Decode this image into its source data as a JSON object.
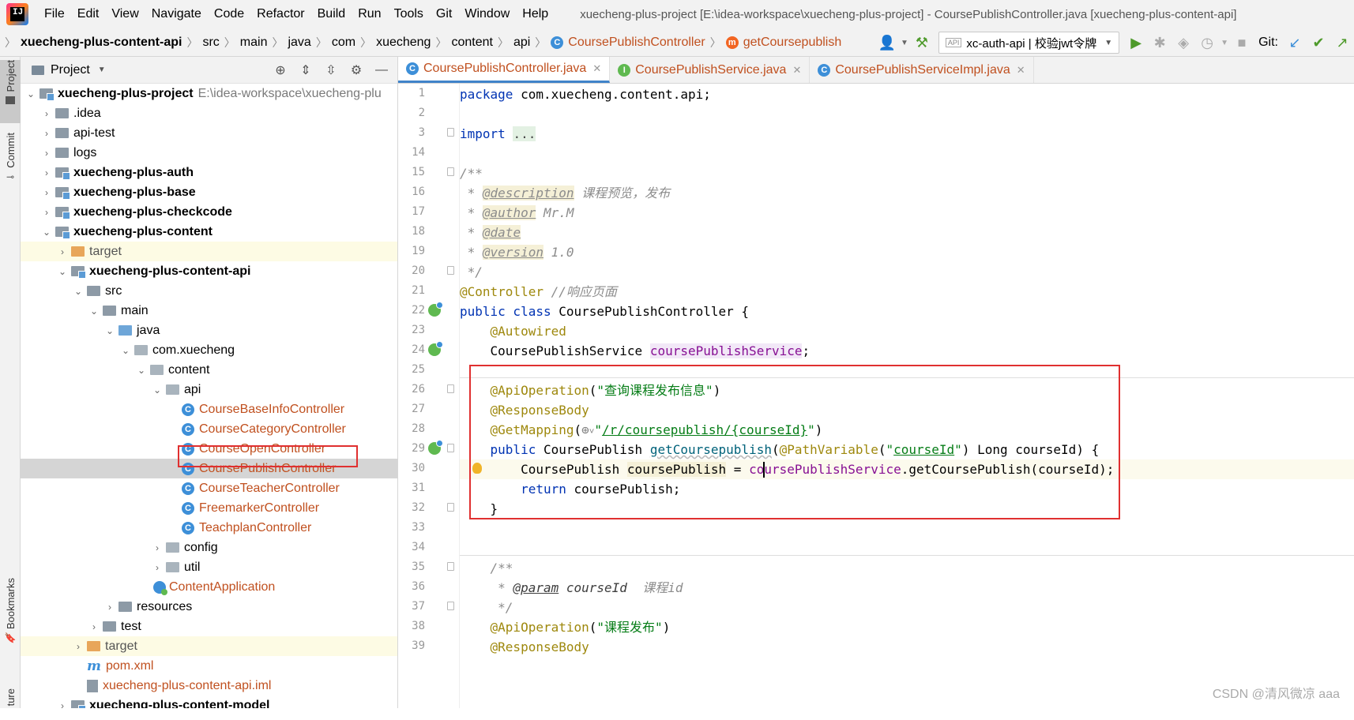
{
  "menubar": {
    "items": [
      "File",
      "Edit",
      "View",
      "Navigate",
      "Code",
      "Refactor",
      "Build",
      "Run",
      "Tools",
      "Git",
      "Window",
      "Help"
    ],
    "title": "xuecheng-plus-project [E:\\idea-workspace\\xuecheng-plus-project] - CoursePublishController.java [xuecheng-plus-content-api]"
  },
  "navbar": {
    "crumbs": [
      "xuecheng-plus-content-api",
      "src",
      "main",
      "java",
      "com",
      "xuecheng",
      "content",
      "api",
      "CoursePublishController",
      "getCoursepublish"
    ],
    "run_config": "xc-auth-api | 校验jwt令牌",
    "api_badge": "API",
    "git_label": "Git:"
  },
  "left_strip": {
    "project": "Project",
    "commit": "Commit",
    "bookmarks": "Bookmarks",
    "structure": "ture"
  },
  "project_panel": {
    "title": "Project",
    "tree": [
      {
        "label": "xuecheng-plus-project",
        "path": "E:\\idea-workspace\\xuecheng-plu"
      },
      {
        "label": ".idea"
      },
      {
        "label": "api-test"
      },
      {
        "label": "logs"
      },
      {
        "label": "xuecheng-plus-auth"
      },
      {
        "label": "xuecheng-plus-base"
      },
      {
        "label": "xuecheng-plus-checkcode"
      },
      {
        "label": "xuecheng-plus-content"
      },
      {
        "label": "target"
      },
      {
        "label": "xuecheng-plus-content-api"
      },
      {
        "label": "src"
      },
      {
        "label": "main"
      },
      {
        "label": "java"
      },
      {
        "label": "com.xuecheng"
      },
      {
        "label": "content"
      },
      {
        "label": "api"
      },
      {
        "label": "CourseBaseInfoController"
      },
      {
        "label": "CourseCategoryController"
      },
      {
        "label": "CourseOpenController"
      },
      {
        "label": "CoursePublishController"
      },
      {
        "label": "CourseTeacherController"
      },
      {
        "label": "FreemarkerController"
      },
      {
        "label": "TeachplanController"
      },
      {
        "label": "config"
      },
      {
        "label": "util"
      },
      {
        "label": "ContentApplication"
      },
      {
        "label": "resources"
      },
      {
        "label": "test"
      },
      {
        "label": "target"
      },
      {
        "label": "pom.xml"
      },
      {
        "label": "xuecheng-plus-content-api.iml"
      },
      {
        "label": "xuecheng-plus-content-model"
      }
    ]
  },
  "editor": {
    "tabs": [
      {
        "label": "CoursePublishController.java",
        "active": true,
        "icon": "class-icon"
      },
      {
        "label": "CoursePublishService.java",
        "active": false,
        "icon": "interface-icon"
      },
      {
        "label": "CoursePublishServiceImpl.java",
        "active": false,
        "icon": "class-icon"
      }
    ],
    "line_numbers": [
      "1",
      "2",
      "3",
      "14",
      "15",
      "16",
      "17",
      "18",
      "19",
      "20",
      "21",
      "22",
      "23",
      "24",
      "25",
      "26",
      "27",
      "28",
      "29",
      "30",
      "31",
      "32",
      "33",
      "34",
      "35",
      "36",
      "37",
      "38",
      "39"
    ],
    "code": {
      "l1_kw": "package",
      "l1_rest": " com.xuecheng.content.api;",
      "l3_kw": "import",
      "l3_fold": "...",
      "l15": "/**",
      "l16_star": " * ",
      "l16_tag": "@description",
      "l16_text": " 课程预览，发布",
      "l17_star": " * ",
      "l17_tag": "@author",
      "l17_text": " Mr.M",
      "l18_star": " * ",
      "l18_tag": "@date",
      "l19_star": " * ",
      "l19_tag": "@version",
      "l19_text": " 1.0",
      "l20": " */",
      "l21_ann": "@Controller",
      "l21_cmt": " //响应页面",
      "l22_kw": "public class",
      "l22_name": " CoursePublishController ",
      "l22_brace": "{",
      "l23_ann": "@Autowired",
      "l24_type": "CoursePublishService ",
      "l24_field": "coursePublishService",
      "l24_semi": ";",
      "l26_ann": "@ApiOperation",
      "l26_p1": "(",
      "l26_str": "\"查询课程发布信息\"",
      "l26_p2": ")",
      "l27_ann": "@ResponseBody",
      "l28_ann": "@GetMapping",
      "l28_p1": "(",
      "l28_globe": "⊕",
      "l28_str1": "\"",
      "l28_path": "/r/coursepublish/{courseId}",
      "l28_str2": "\"",
      "l28_p2": ")",
      "l29_kw": "public",
      "l29_type": " CoursePublish ",
      "l29_meth": "getCoursepublish",
      "l29_p1": "(",
      "l29_ann": "@PathVariable",
      "l29_p2": "(",
      "l29_s1": "\"",
      "l29_sname": "courseId",
      "l29_s2": "\"",
      "l29_p3": ")",
      "l29_rest": " Long courseId) {",
      "l30_type": "CoursePublish ",
      "l30_var": "coursePublish",
      "l30_eq": " = ",
      "l30_field": "coursePublishService",
      "l30_rest": ".getCoursePublish(courseId);",
      "l31_kw": "return",
      "l31_rest": " coursePublish;",
      "l32": "}",
      "l35": "/**",
      "l36_star": " * ",
      "l36_tag": "@param",
      "l36_name": " courseId",
      "l36_text": "  课程id",
      "l37": " */",
      "l38_ann": "@ApiOperation",
      "l38_p1": "(",
      "l38_str": "\"课程发布\"",
      "l38_p2": ")",
      "l39_ann": "@ResponseBody"
    }
  },
  "watermark": "CSDN @清风微凉 aaa"
}
